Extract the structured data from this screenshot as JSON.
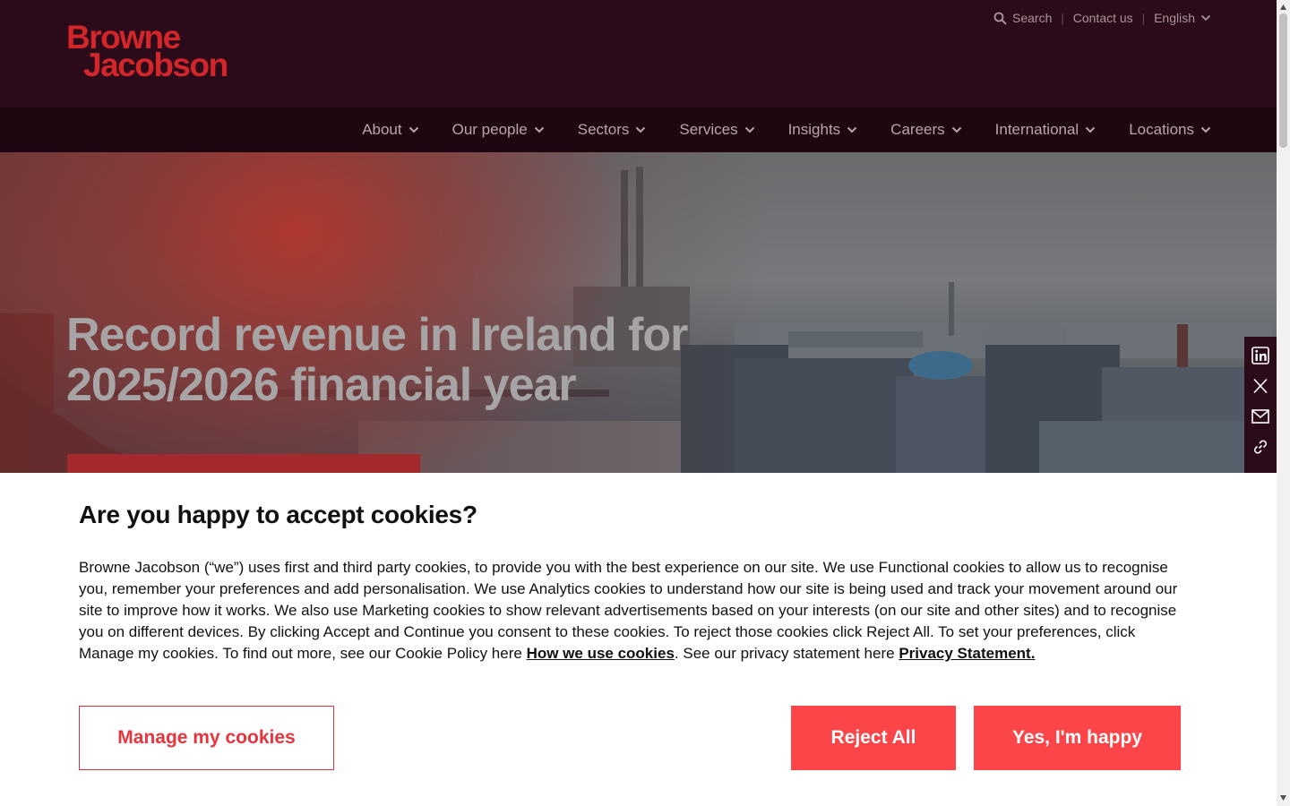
{
  "header": {
    "logo_line1": "Browne",
    "logo_line2": "Jacobson",
    "utility": {
      "search_label": "Search",
      "contact_label": "Contact us",
      "language_label": "English",
      "separator": "|"
    }
  },
  "nav": {
    "items": [
      "About",
      "Our people",
      "Sectors",
      "Services",
      "Insights",
      "Careers",
      "International",
      "Locations"
    ]
  },
  "hero": {
    "title": "Record revenue in Ireland for 2025/2026 financial year"
  },
  "share": {
    "icons": [
      "linkedin-icon",
      "x-icon",
      "email-icon",
      "link-icon"
    ]
  },
  "cookie_banner": {
    "title": "Are you happy to accept cookies?",
    "body_text": "Browne Jacobson (“we”) uses first and third party cookies, to provide you with the best experience on our site. We use Functional cookies to allow us to recognise you, remember your preferences and add personalisation. We use Analytics cookies to understand how our site is being used and track your movement around our site to improve how it works. We also use Marketing cookies to show relevant advertisements based on your interests (on our site and other sites) and to recognise you on different devices. By clicking Accept and Continue you consent to these cookies. To reject those cookies click Reject All. To set your preferences, click Manage my cookies. To find out more, see our Cookie Policy here ",
    "cookie_link": "How we use cookies",
    "middle_text": ". See our privacy statement here ",
    "privacy_link": "Privacy Statement.",
    "manage_label": "Manage my cookies",
    "reject_label": "Reject All",
    "accept_label": "Yes, I'm happy"
  },
  "colors": {
    "header_bg": "#2b0a19",
    "nav_bg": "#1f0712",
    "brand_red": "#d2262b",
    "button_red": "#fb4548"
  }
}
